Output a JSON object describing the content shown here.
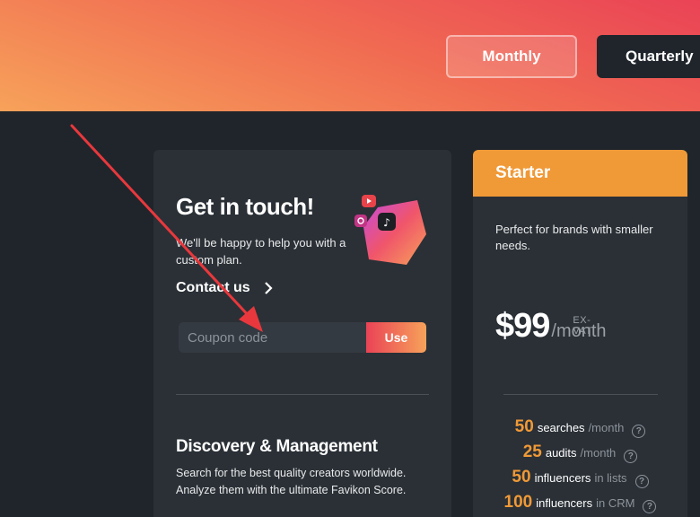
{
  "billing": {
    "monthly_label": "Monthly",
    "quarterly_label": "Quarterly"
  },
  "contact_card": {
    "title": "Get in touch!",
    "subtitle": "We'll be happy to help you with a custom plan.",
    "contact_label": "Contact us",
    "coupon_placeholder": "Coupon code",
    "use_label": "Use",
    "section_title": "Discovery & Management",
    "section_desc": "Search for the best quality creators worldwide. Analyze them with the ultimate Favikon Score."
  },
  "plan": {
    "name": "Starter",
    "description": "Perfect for brands with smaller needs.",
    "price": "$99",
    "vat_label": "EX-VAT",
    "period": "/month",
    "features": [
      {
        "num": "50",
        "text": "searches",
        "unit": "/month"
      },
      {
        "num": "25",
        "text": "audits",
        "unit": "/month"
      },
      {
        "num": "50",
        "text": "influencers",
        "unit": "in lists"
      },
      {
        "num": "100",
        "text": "influencers",
        "unit": "in CRM"
      }
    ]
  },
  "colors": {
    "accent_orange": "#f09937",
    "gradient_red": "#ea4356",
    "gradient_peach": "#f7a25a",
    "background": "#1f252b",
    "card": "#2a3036",
    "annotation_arrow": "#e8383d"
  }
}
